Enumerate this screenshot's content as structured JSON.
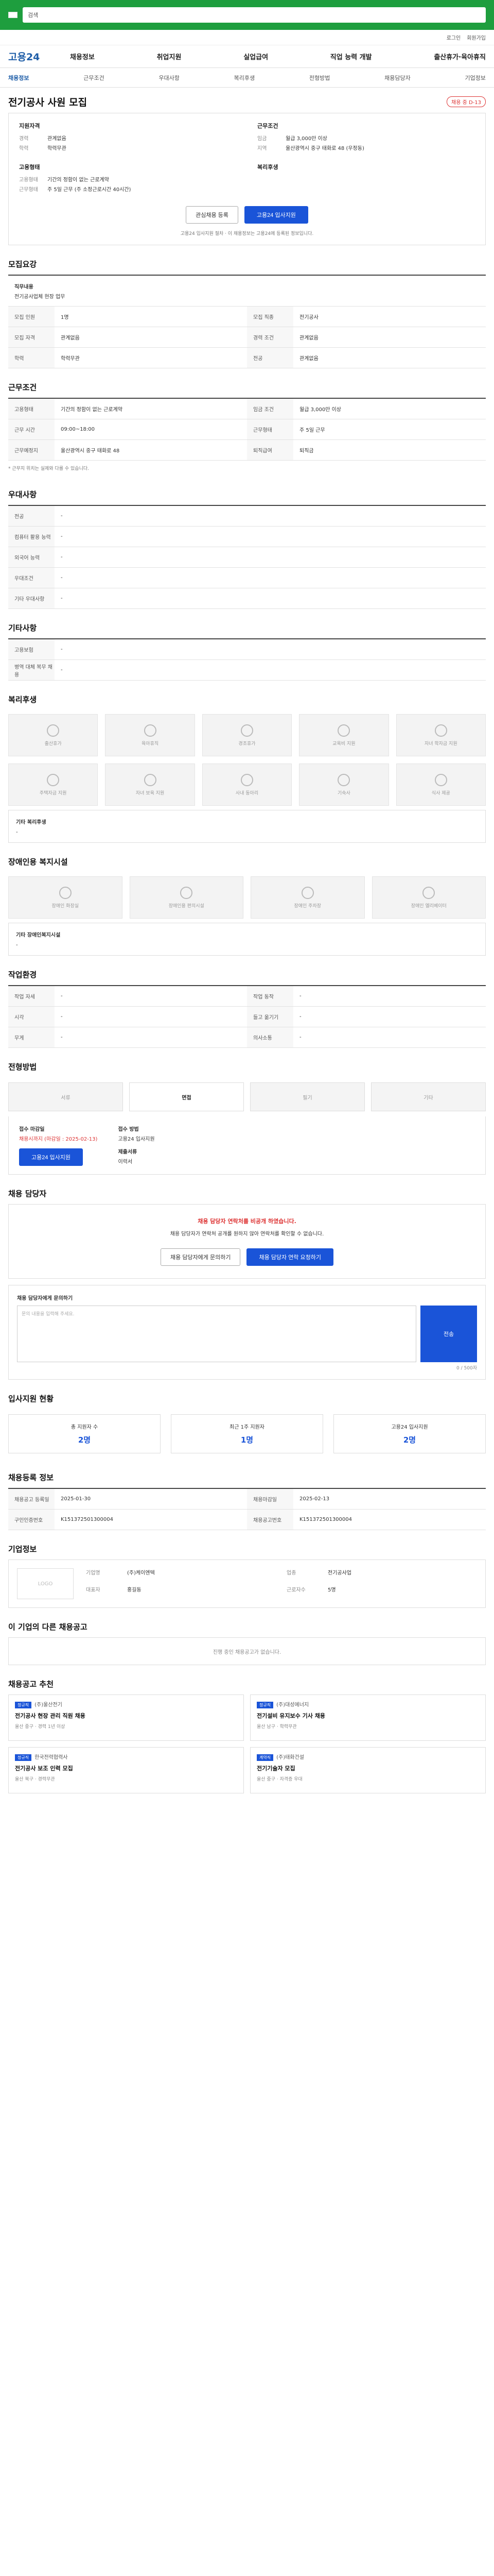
{
  "site": {
    "logo": "고용24",
    "search_placeholder": "검색",
    "utility": [
      "로그인",
      "회원가입"
    ]
  },
  "gnb": [
    "채용정보",
    "취업지원",
    "실업급여",
    "직업 능력 개발",
    "출산휴가·육아휴직"
  ],
  "tabs": [
    "채용정보",
    "근무조건",
    "우대사항",
    "복리후생",
    "전형방법",
    "채용담당자",
    "기업정보"
  ],
  "job": {
    "title": "전기공사 사원 모집",
    "status": "채용 중 D-13"
  },
  "summary": {
    "left_title": "지원자격",
    "exp": "관계없음",
    "edu": "학력무관",
    "company_title": "고용형태",
    "type": "기간의 정함이 없는 근로계약",
    "hours": "주 5일 근무 (주 소정근로시간 40시간)",
    "right_title": "근무조건",
    "pay": "월급 3,000만 이상",
    "location": "울산광역시 중구 태화로 48 (우정동)",
    "welfare_title": "복리후생"
  },
  "actions": {
    "interest": "관심채용 등록",
    "apply": "고용24 입사지원"
  },
  "note": "고용24 입사지원 절차 · 이 채용정보는 고용24에 등록된 정보입니다.",
  "recruit": {
    "title": "모집요강",
    "job_label": "직무내용",
    "job_text": "전기공사업체 현장 업무",
    "rows": [
      [
        "모집 인원",
        "1명",
        "모집 직종",
        "전기공사"
      ],
      [
        "모집 자격",
        "관계없음",
        "경력 조건",
        "관계없음"
      ],
      [
        "학력",
        "학력무관",
        "전공",
        "관계없음"
      ]
    ]
  },
  "work": {
    "title": "근무조건",
    "rows": [
      [
        "고용형태",
        "기간의 정함이 없는 근로계약",
        "임금 조건",
        "월급 3,000만 이상"
      ],
      [
        "근무 시간",
        "09:00~18:00",
        "근무형태",
        "주 5일 근무"
      ],
      [
        "근무예정지",
        "울산광역시 중구 태화로 48",
        "퇴직급여",
        "퇴직금"
      ]
    ],
    "note": "* 근무지 위치는 실제와 다를 수 있습니다."
  },
  "pref": {
    "title": "우대사항",
    "rows": [
      "전공",
      "컴퓨터 활용 능력",
      "외국어 능력",
      "우대조건",
      "기타 우대사항"
    ]
  },
  "other": {
    "title": "기타사항",
    "rows": [
      "고용보험",
      "병역 대체 복무 채용"
    ]
  },
  "welfare": {
    "title": "복리후생",
    "items": [
      "출산휴가",
      "육아휴직",
      "경조휴가",
      "교육비 지원",
      "자녀 학자금 지원",
      "주택자금 지원",
      "자녀 보육 지원",
      "사내 동아리",
      "기숙사",
      "식사 제공"
    ],
    "other_label": "기타 복리후생"
  },
  "disabled": {
    "title": "장애인용 복지시설",
    "items": [
      "장애인 화장실",
      "장애인용 편의시설",
      "장애인 주차장",
      "장애인 엘리베이터"
    ],
    "other_label": "기타 장애인복지시설"
  },
  "env": {
    "title": "작업환경",
    "rows": [
      "작업 자세",
      "작업 동작",
      "시각",
      "들고 옮기기",
      "무게",
      "의사소통"
    ]
  },
  "method": {
    "title": "전형방법",
    "items": [
      "서류",
      "면접",
      "필기",
      "기타"
    ],
    "deadline_label": "접수 마감일",
    "deadline": "채용시까지 (마감일 : 2025-02-13)",
    "apply_label": "접수 방법",
    "apply_method": "고용24 입사지원",
    "doc_label": "제출서류",
    "doc": "이력서"
  },
  "manager": {
    "title": "채용 담당자",
    "warn": "채용 담당자 연락처를 비공개 하였습니다.",
    "desc": "채용 담당자가 연락처 공개를 원하지 않아 연락처를 확인할 수 없습니다.",
    "btn1": "채용 담당자에게 문의하기",
    "btn2": "채용 담당자 연락 요청하기",
    "qa_title": "채용 담당자에게 문의하기",
    "qa_count": "0 / 500자",
    "qa_placeholder": "문의 내용을 입력해 주세요.",
    "send": "전송"
  },
  "stats": {
    "title": "입사지원 현황",
    "items": [
      [
        "총 지원자 수",
        "2명"
      ],
      [
        "최근 1주 지원자",
        "1명"
      ],
      [
        "고용24 입사지원",
        "2명"
      ]
    ]
  },
  "info": {
    "title": "채용등록 정보",
    "rows": [
      [
        "채용공고 등록일",
        "2025-01-30",
        "채용마감일",
        "2025-02-13"
      ],
      [
        "구인인증번호",
        "K151372501300004",
        "채용공고번호",
        "K151372501300004"
      ]
    ]
  },
  "company": {
    "title": "기업정보",
    "logo": "LOGO",
    "rows": [
      [
        "기업명",
        "(주)케이엔텍"
      ],
      [
        "업종",
        "전기공사업"
      ],
      [
        "대표자",
        "홍길동"
      ],
      [
        "근로자수",
        "5명"
      ]
    ]
  },
  "other_jobs": {
    "title": "이 기업의 다른 채용공고",
    "empty": "진행 중인 채용공고가 없습니다."
  },
  "similar": {
    "title": "채용공고 추천",
    "jobs": [
      {
        "tag": "정규직",
        "company": "(주)울산전기",
        "title": "전기공사 현장 관리 직원 채용",
        "meta": "울산 중구 · 경력 1년 이상"
      },
      {
        "tag": "정규직",
        "company": "(주)대성에너지",
        "title": "전기설비 유지보수 기사 채용",
        "meta": "울산 남구 · 학력무관"
      },
      {
        "tag": "정규직",
        "company": "한국전력협력사",
        "title": "전기공사 보조 인력 모집",
        "meta": "울산 북구 · 경력무관"
      },
      {
        "tag": "계약직",
        "company": "(주)태화건설",
        "title": "전기기술자 모집",
        "meta": "울산 중구 · 자격증 우대"
      }
    ]
  }
}
